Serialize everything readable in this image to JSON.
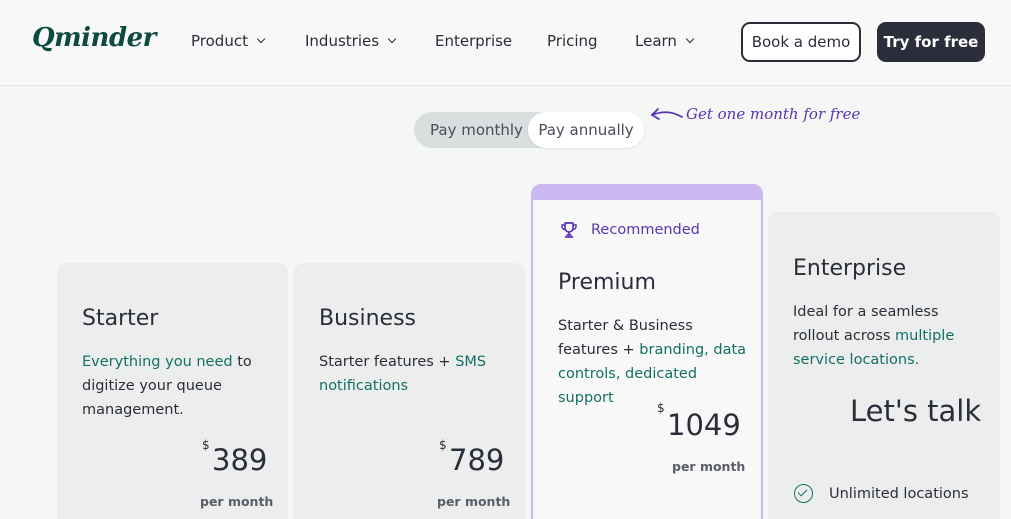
{
  "nav": {
    "logo": "Qminder",
    "items": [
      {
        "label": "Product",
        "has_dropdown": true
      },
      {
        "label": "Industries",
        "has_dropdown": true
      },
      {
        "label": "Enterprise",
        "has_dropdown": false
      },
      {
        "label": "Pricing",
        "has_dropdown": false
      },
      {
        "label": "Learn",
        "has_dropdown": true
      }
    ],
    "demo_button": "Book a demo",
    "try_button": "Try for free"
  },
  "billing": {
    "monthly": "Pay monthly",
    "annually": "Pay annually",
    "selected": "annually",
    "promo": "Get one month for free"
  },
  "plans": {
    "starter": {
      "name": "Starter",
      "desc_hl": "Everything you need",
      "desc_rest_1": " to",
      "desc_rest_2": "digitize your queue",
      "desc_rest_3": "management.",
      "currency": "$",
      "price": "389",
      "period": "per month"
    },
    "business": {
      "name": "Business",
      "desc_1": "Starter features + ",
      "desc_hl_1": "SMS",
      "desc_hl_2": "notifications",
      "currency": "$",
      "price": "789",
      "period": "per month"
    },
    "premium": {
      "badge": "Recommended",
      "name": "Premium",
      "desc_1": "Starter & Business",
      "desc_2": "features + ",
      "desc_hl_1": "branding, data",
      "desc_hl_2": "controls, dedicated",
      "desc_hl_3": "support",
      "currency": "$",
      "price": "1049",
      "period": "per month"
    },
    "enterprise": {
      "name": "Enterprise",
      "desc_1": "Ideal for a seamless",
      "desc_2": "rollout across ",
      "desc_hl_1": "multiple",
      "desc_hl_2": "service locations.",
      "cta": "Let's talk",
      "feature_1": "Unlimited locations"
    }
  },
  "colors": {
    "accent_green": "#137064",
    "accent_purple": "#5a35b0",
    "premium_border": "#c9b8ef",
    "dark": "#2b2d3a"
  }
}
